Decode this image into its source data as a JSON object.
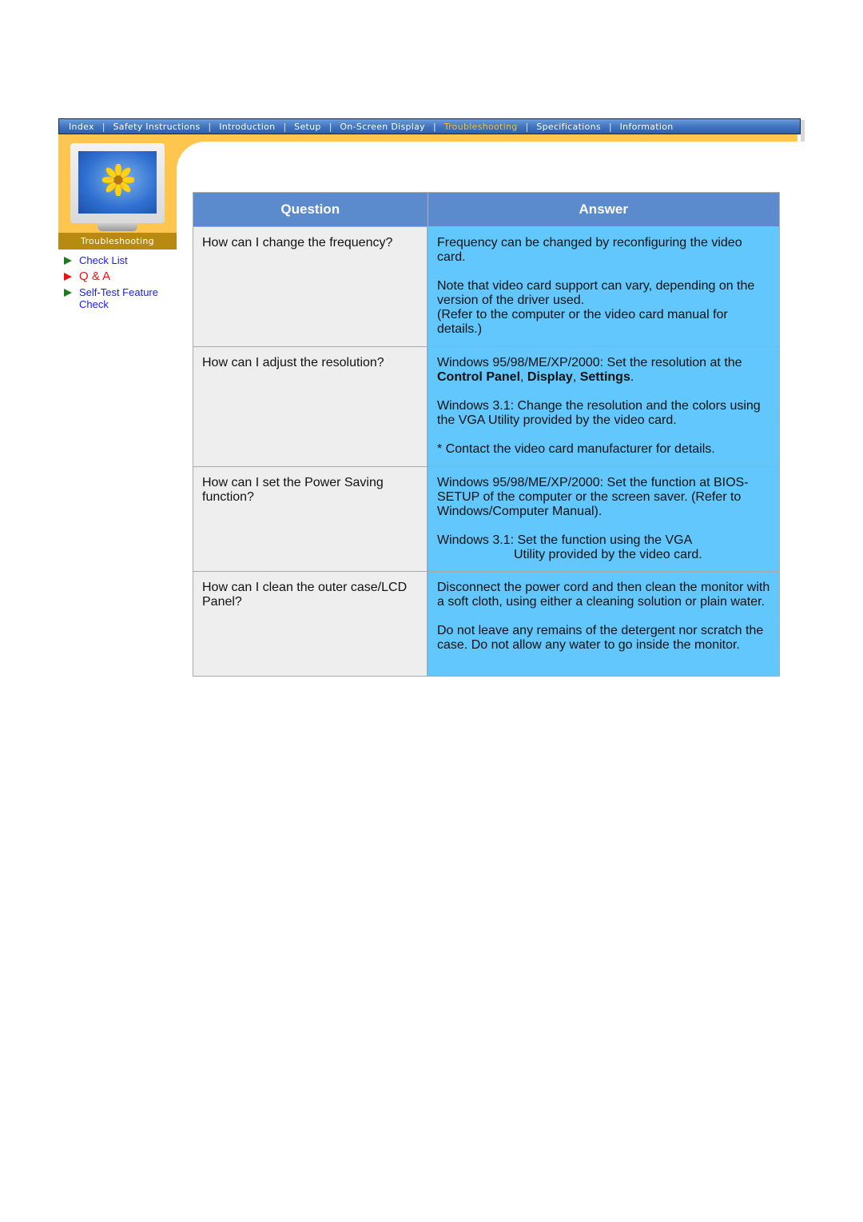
{
  "nav": {
    "items": [
      {
        "label": "Index"
      },
      {
        "label": "Safety Instructions"
      },
      {
        "label": "Introduction"
      },
      {
        "label": "Setup"
      },
      {
        "label": "On-Screen Display"
      },
      {
        "label": "Troubleshooting",
        "active": true
      },
      {
        "label": "Specifications"
      },
      {
        "label": "Information"
      }
    ],
    "separator": "|",
    "active_color": "#f5c02c"
  },
  "sidebar": {
    "section_label": "Troubleshooting",
    "links": [
      {
        "label": "Check List",
        "icon": "green-triangle-icon"
      },
      {
        "label": "Q & A",
        "icon": "red-triangle-icon",
        "active": true
      },
      {
        "label": "Self-Test Feature Check",
        "line1": "Self-Test Feature",
        "line2": "Check",
        "icon": "green-triangle-icon"
      }
    ]
  },
  "table": {
    "headers": {
      "question": "Question",
      "answer": "Answer"
    },
    "rows": [
      {
        "question": "How can I change the frequency?",
        "answer": {
          "p1": "Frequency can be changed by reconfiguring the video card.",
          "p2a": "Note that video card support can vary, depending on the version of the driver used.",
          "p2b": "(Refer to the computer or the video card manual for details.)"
        }
      },
      {
        "question": "How can I adjust the resolution?",
        "answer": {
          "p1_text": "Windows 95/98/ME/XP/2000: Set the resolution at the ",
          "p1_b1": "Control Panel",
          "p1_c1": ", ",
          "p1_b2": "Display",
          "p1_c2": ", ",
          "p1_b3": "Settings",
          "p1_end": ".",
          "p2": "Windows 3.1: Change the resolution and the colors using the VGA Utility provided by the video card.",
          "p3": "* Contact the video card manufacturer for details."
        }
      },
      {
        "question": "How can I set the Power Saving function?",
        "answer": {
          "p1": "Windows 95/98/ME/XP/2000: Set the function at BIOS-SETUP of the computer or the screen saver. (Refer to Windows/Computer Manual).",
          "p2a": "Windows 3.1: Set the function using the VGA",
          "p2b": "Utility provided by the video card."
        }
      },
      {
        "question": "How can I clean the outer case/LCD Panel?",
        "answer": {
          "p1": "Disconnect the power cord and then clean the monitor with a soft cloth, using either a cleaning solution or plain water.",
          "p2": "Do not leave any remains of the detergent nor scratch the case. Do not allow any water to go inside the monitor."
        }
      }
    ]
  },
  "colors": {
    "nav_blue": "#3f73bf",
    "orange": "#ffc64f",
    "header_blue": "#5b8bcd",
    "answer_cyan": "#62c7fc",
    "question_gray": "#eeeeee",
    "link_blue": "#1a1aff",
    "active_red": "#ee1111"
  }
}
